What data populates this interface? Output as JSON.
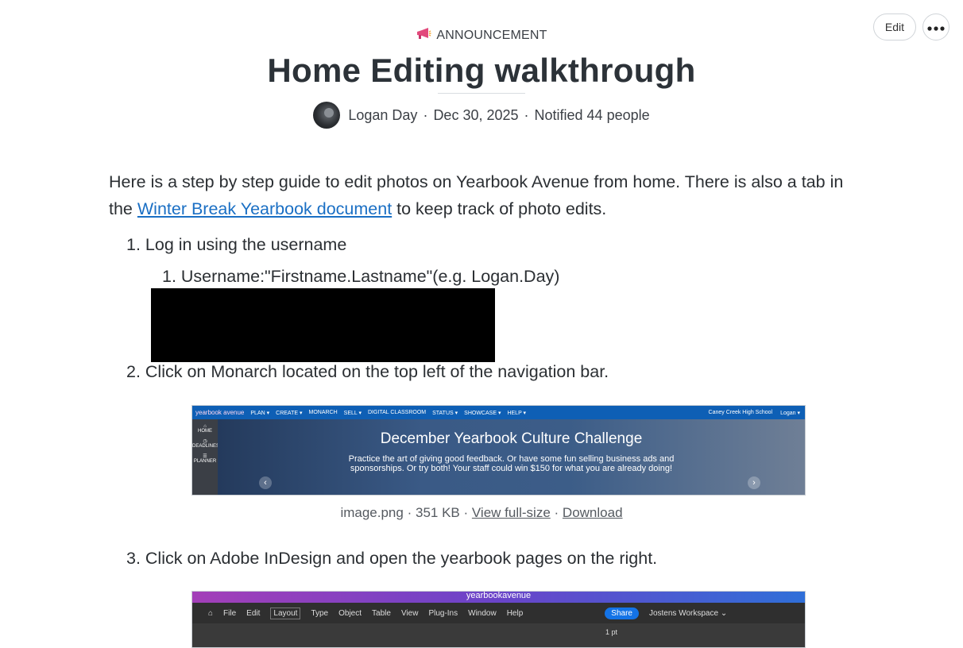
{
  "header": {
    "kind_icon": "megaphone-icon",
    "kind_label": "ANNOUNCEMENT",
    "title": "Home Editing walkthrough",
    "author": "Logan Day",
    "date": "Dec 30, 2025",
    "notified": "Notified 44 people",
    "separator": "·"
  },
  "toolbar": {
    "edit_label": "Edit",
    "more_icon": "ellipsis-icon"
  },
  "body": {
    "intro_before": "Here is a step by step guide to edit photos on Yearbook Avenue from home. There is also a tab in the ",
    "intro_link": "Winter Break Yearbook document",
    "intro_after": " to keep track of photo edits.",
    "steps": [
      "1. Log in using the username",
      "2. Click on Monarch located on the top left of the navigation bar.",
      "3. Click on Adobe InDesign and open the yearbook pages on the right."
    ],
    "substep": "1. Username:\"Firstname.Lastname\"(e.g. Logan.Day)"
  },
  "attachment1": {
    "nav_logo": "yearbook avenue",
    "nav_items": [
      "PLAN ▾",
      "CREATE ▾",
      "MONARCH",
      "SELL ▾",
      "DIGITAL CLASSROOM",
      "STATUS ▾",
      "SHOWCASE ▾",
      "HELP ▾"
    ],
    "nav_school": "Caney Creek High School",
    "nav_user": "Logan ▾",
    "side_items": [
      "HOME",
      "DEADLINES",
      "PLANNER"
    ],
    "hero_title": "December Yearbook Culture Challenge",
    "hero_text": "Practice the art of giving good feedback. Or have some fun selling business ads and sponsorships. Or try both! Your staff could win $150 for what you are already doing!",
    "file_name": "image.png",
    "file_size": "351 KB",
    "view_label": "View full-size",
    "download_label": "Download"
  },
  "attachment2": {
    "top_label": "yearbookavenue",
    "menu": [
      "File",
      "Edit",
      "Layout",
      "Type",
      "Object",
      "Table",
      "View",
      "Plug-Ins",
      "Window",
      "Help"
    ],
    "share_label": "Share",
    "workspace": "Jostens Workspace ⌄",
    "stroke": "1 pt"
  }
}
